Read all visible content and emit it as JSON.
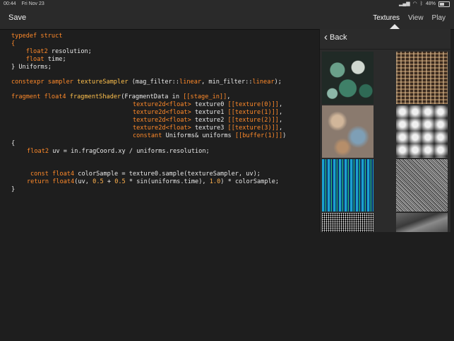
{
  "status": {
    "time": "00:44",
    "date": "Fri Nov 23",
    "battery": "48%"
  },
  "toolbar": {
    "save_label": "Save"
  },
  "nav": {
    "tabs": [
      "Textures",
      "View",
      "Play"
    ],
    "active": "Textures"
  },
  "panel": {
    "back_label": "Back",
    "texture_count": 8
  },
  "code": {
    "l1": "typedef struct",
    "l2": "{",
    "l3_t": "float2",
    "l3_n": " resolution;",
    "l4_t": "float",
    "l4_n": " time;",
    "l5": "} Uniforms;",
    "l6_a": "constexpr sampler",
    "l6_b": " textureSampler",
    " l6_c": "",
    "l6_c": " (mag_filter::",
    "l6_d": "linear",
    "l6_e": ", min_filter::",
    "l6_f": "linear",
    "l6_g": ");",
    "l7_a": "fragment float4",
    "l7_b": " fragmentShader",
    "l7_c": "(FragmentData in ",
    "l7_d": "[[stage_in]]",
    "l7_e": ",",
    "l8_a": "texture2d<float>",
    "l8_b": " texture0 ",
    "l8_c": "[[texture(0)]]",
    "l8_d": ",",
    "l9_a": "texture2d<float>",
    "l9_b": " texture1 ",
    "l9_c": "[[texture(1)]]",
    "l9_d": ",",
    "l10_a": "texture2d<float>",
    "l10_b": " texture2 ",
    "l10_c": "[[texture(2)]]",
    "l10_d": ",",
    "l11_a": "texture2d<float>",
    "l11_b": " texture3 ",
    "l11_c": "[[texture(3)]]",
    "l11_d": ",",
    "l12_a": "constant",
    "l12_b": " Uniforms& uniforms ",
    "l12_c": "[[buffer(1)]]",
    "l12_d": ")",
    "l13": "{",
    "l14_a": "float2",
    "l14_b": " uv = in.fragCoord.xy / uniforms.resolution;",
    "l15_a": "const float4",
    "l15_b": " colorSample = texture0.sample(textureSampler, uv);",
    "l16_a": "return",
    "l16_b": " float4",
    "l16_c": "(uv, ",
    "l16_d": "0.5",
    "l16_e": " + ",
    "l16_f": "0.5",
    "l16_g": " * sin(uniforms.time), ",
    "l16_h": "1.0",
    "l16_i": ") * colorSample;",
    "l17": "}"
  }
}
